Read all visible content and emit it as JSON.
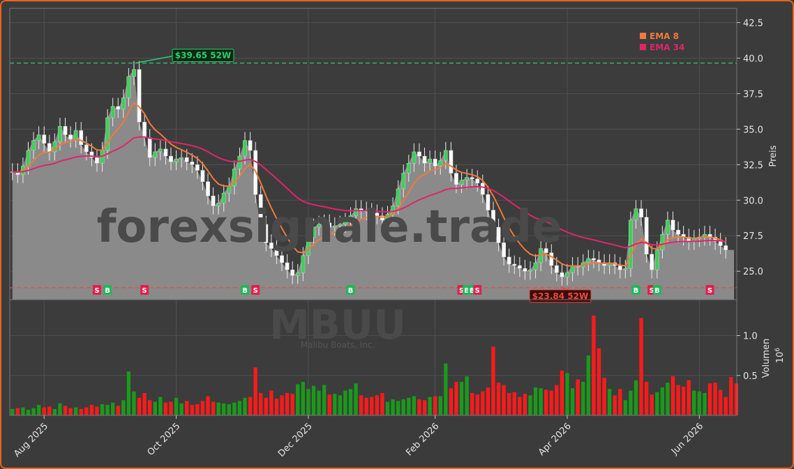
{
  "chart_data": {
    "type": "candlestick",
    "watermark": {
      "site": "forexsignale.trade",
      "ticker": "MBUU",
      "company": "Malibu Boats, Inc."
    },
    "x_tick_labels": [
      "Aug 2025",
      "Oct 2025",
      "Dec 2025",
      "Feb 2026",
      "Apr 2026",
      "Jun 2026"
    ],
    "price_axis": {
      "label": "Preis",
      "ylim": [
        23.0,
        43.5
      ],
      "ticks": [
        "25.0",
        "27.5",
        "30.0",
        "32.5",
        "35.0",
        "37.5",
        "40.0",
        "42.5"
      ]
    },
    "volume_axis": {
      "label": "Volumen",
      "exponent": "10",
      "power": "6",
      "ylim": [
        0,
        1.45
      ],
      "ticks": [
        "0.5",
        "1.0"
      ]
    },
    "legend": [
      {
        "label": "EMA 8",
        "color": "#f07a3a"
      },
      {
        "label": "EMA 34",
        "color": "#e0256a"
      }
    ],
    "annotations": {
      "high_52w": {
        "label": "$39.65 52W",
        "value": 39.65,
        "color": "#2ecc71"
      },
      "low_52w": {
        "label": "$23.84 52W",
        "value": 23.84,
        "color": "#e74c3c"
      }
    },
    "signals": [
      {
        "type": "S",
        "date_index": 16
      },
      {
        "type": "B",
        "date_index": 18
      },
      {
        "type": "S",
        "date_index": 25
      },
      {
        "type": "B",
        "date_index": 44
      },
      {
        "type": "S",
        "date_index": 46
      },
      {
        "type": "B",
        "date_index": 64
      },
      {
        "type": "S",
        "date_index": 85
      },
      {
        "type": "B",
        "date_index": 86
      },
      {
        "type": "B",
        "date_index": 87
      },
      {
        "type": "S",
        "date_index": 88
      },
      {
        "type": "B",
        "date_index": 118
      },
      {
        "type": "S",
        "date_index": 121
      },
      {
        "type": "B",
        "date_index": 122
      },
      {
        "type": "S",
        "date_index": 132
      }
    ],
    "close": [
      32.0,
      31.8,
      32.4,
      33.5,
      34.2,
      34.6,
      34.0,
      33.4,
      34.1,
      35.2,
      34.6,
      34.3,
      34.9,
      33.9,
      33.4,
      33.0,
      32.6,
      33.5,
      35.8,
      36.6,
      36.4,
      37.2,
      38.7,
      39.2,
      35.5,
      34.4,
      33.0,
      33.4,
      33.6,
      33.1,
      32.7,
      32.9,
      33.0,
      32.7,
      32.5,
      32.1,
      31.3,
      30.3,
      29.6,
      29.8,
      30.5,
      31.0,
      32.2,
      33.1,
      34.2,
      33.5,
      30.4,
      28.3,
      27.0,
      26.6,
      26.1,
      25.6,
      25.1,
      24.7,
      24.9,
      26.1,
      27.4,
      28.1,
      28.3,
      28.4,
      28.1,
      28.2,
      28.3,
      28.5,
      28.9,
      29.4,
      29.3,
      29.2,
      29.1,
      28.9,
      28.6,
      29.0,
      29.6,
      30.8,
      31.9,
      32.6,
      33.4,
      33.1,
      32.6,
      32.9,
      32.4,
      32.8,
      33.5,
      31.9,
      31.1,
      31.4,
      31.6,
      31.5,
      31.2,
      30.4,
      29.3,
      28.1,
      27.0,
      26.0,
      25.5,
      25.4,
      25.2,
      25.0,
      25.1,
      25.6,
      26.6,
      26.3,
      25.4,
      24.9,
      24.6,
      24.9,
      25.4,
      25.3,
      25.6,
      25.9,
      25.8,
      25.6,
      25.4,
      25.6,
      25.4,
      25.1,
      25.2,
      28.6,
      29.4,
      28.8,
      26.2,
      25.1,
      26.5,
      27.6,
      28.6,
      27.9,
      27.6,
      27.4,
      27.1,
      27.3,
      27.4,
      27.6,
      27.4,
      27.1,
      26.8,
      26.5
    ],
    "volume": [
      0.08,
      0.09,
      0.1,
      0.07,
      0.09,
      0.13,
      0.1,
      0.11,
      0.08,
      0.15,
      0.12,
      0.09,
      0.1,
      0.08,
      0.1,
      0.13,
      0.11,
      0.14,
      0.13,
      0.16,
      0.12,
      0.19,
      0.55,
      0.3,
      0.22,
      0.28,
      0.19,
      0.17,
      0.23,
      0.16,
      0.17,
      0.22,
      0.15,
      0.18,
      0.13,
      0.14,
      0.18,
      0.24,
      0.17,
      0.16,
      0.15,
      0.14,
      0.16,
      0.18,
      0.22,
      0.23,
      0.6,
      0.28,
      0.22,
      0.31,
      0.21,
      0.25,
      0.28,
      0.27,
      0.39,
      0.42,
      0.33,
      0.37,
      0.31,
      0.38,
      0.26,
      0.27,
      0.25,
      0.31,
      0.33,
      0.4,
      0.25,
      0.22,
      0.23,
      0.25,
      0.28,
      0.17,
      0.2,
      0.18,
      0.2,
      0.22,
      0.24,
      0.2,
      0.19,
      0.23,
      0.24,
      0.24,
      0.65,
      0.34,
      0.42,
      0.42,
      0.49,
      0.28,
      0.26,
      0.3,
      0.35,
      0.86,
      0.41,
      0.38,
      0.28,
      0.29,
      0.23,
      0.27,
      0.25,
      0.35,
      0.34,
      0.32,
      0.31,
      0.38,
      0.56,
      0.53,
      0.34,
      0.45,
      0.42,
      0.75,
      1.25,
      0.84,
      0.47,
      0.33,
      0.25,
      0.33,
      0.19,
      0.31,
      0.44,
      1.22,
      0.42,
      0.26,
      0.29,
      0.35,
      0.41,
      0.49,
      0.38,
      0.36,
      0.44,
      0.31,
      0.3,
      0.28,
      0.4,
      0.41,
      0.32,
      0.23,
      0.48,
      0.4
    ]
  }
}
